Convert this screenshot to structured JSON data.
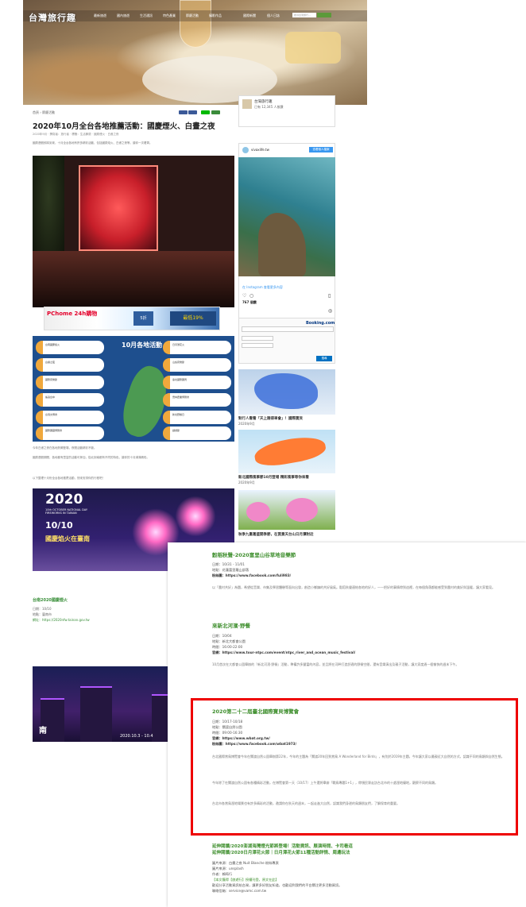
{
  "header": {
    "logo": "台灣旅行趣",
    "nav": [
      "最新旅遊",
      "國內旅遊",
      "生活通訊",
      "特色產業",
      "節慶活動",
      "攝影作品",
      "國際新聞",
      "個人日誌"
    ],
    "search_placeholder": "搜尋台灣旅行..."
  },
  "article": {
    "breadcrumb": "首頁 › 節慶活動",
    "title": "2020年10月全台各地推薦活動：國慶煙火、白晝之夜",
    "meta": "2020年9月 · 撰寫者：旅行者 · 標籤：生活節慶 · 國慶煙火 · 白晝之夜",
    "intro": "國慶連假即將到來，十月全台各地有許多精彩活動，包括國慶焰火、白晝之夜等，讓你一次看齊。",
    "caption1": "今年白晝之夜在各地熱鬧登場，夜間活動精彩不斷。",
    "banner": {
      "brand": "PChome 24h購物",
      "promo1": "5折",
      "promo2": "最低19%"
    },
    "infographic": {
      "title": "10月各地活動",
      "cards": [
        "台南國慶焰火",
        "白晝之夜",
        "國際音樂節",
        "搖滾台中",
        "台灣文博會",
        "國際寶藏博覽會",
        "日月潭花火",
        "山谷音樂節",
        "臺北國際寶貝",
        "雲林農業博覽會",
        "新北野餐日",
        "戲劇節"
      ]
    },
    "para1": "國慶連假期間，各地都有豐富的活動可參加，從北到南都有不同的特色，讓你的十月滿滿精彩。",
    "para2": "以下整理十月份全台各地推薦活動，快來安排你的行程吧！",
    "fireworks": {
      "year": "2020",
      "subtitle": "10th OCTOBER NATIONAL DAY FIREWORKS IN TAINAN",
      "date": "10/10",
      "title": "國慶焰火在臺南"
    },
    "section_title": "台南2020國慶煙火",
    "section_lines": [
      "日期：10/10",
      "地點：臺南市",
      "網址：https://2020nfw.tainan.gov.tw"
    ],
    "photo3": {
      "name": "南",
      "date": "2020.10.3 - 10.4"
    }
  },
  "sidebar": {
    "fb_page": "台灣旅行趣",
    "fb_follow": "已有 12,345 人按讚",
    "ig_user": "vivaxlife.tw",
    "ig_follow": "查看個人檔案",
    "ig_likes": "767 個讚",
    "ig_more": "在 Instagram 查看更多內容",
    "booking": "Booking.com",
    "booking_search": "搜尋",
    "posts": [
      {
        "title": "對行人看看「天上跟得車會」！國際寶貝",
        "date": "2020年9月"
      },
      {
        "title": "新北國際風箏節10月登場 精彩風箏等你來看",
        "date": "2020年9月"
      },
      {
        "title": "秋季九重葛盛開季節，在賞景天台山日月潭附近",
        "date": "2020年9月"
      }
    ]
  },
  "panel": {
    "events": [
      {
        "title": "穀稻秋聲-2020富里山谷草地音樂節",
        "lines": [
          "日期：10/31 - 11/01",
          "地點：花蓮富里羅山部落",
          "粉絲團：https://www.facebook.com/fuli983/"
        ],
        "desc": "以「農村共好」為題，希望從音樂、市集及學習體驗等面向出發，創造小鄉鎮的共好風氣。穀稻秋聲連結各地的好人，一一把好的事情帶到這裡，在每個角落都能感受到農村的美好與溫暖，讓大家看見。"
      },
      {
        "title": "來新北河濱·野餐",
        "lines": [
          "日期：10/04",
          "地點：新北大都會公園",
          "時間：16:00-22:00",
          "官網：https://www.tour-ntpc.com/event/ntpc_river_and_ocean_music_festival/"
        ],
        "desc": "10月首次在大都會公園舉辦的『新北河濱·野餐』活動，準備許多豐富的內容，並且將在河畔打造舒適的野餐空間，還有音樂演出及親子活動，讓大家度過一個愉快的週末下午。"
      },
      {
        "title": "2020第二十二屆臺北國際寶貝博覽會",
        "lines": [
          "日期：10/17-10/18",
          "地點：關渡自然公園",
          "時間：09:00-16:30",
          "官網：https://www.wbat.org.tw/",
          "粉絲團：https://www.facebook.com/wbat1973/"
        ],
        "desc": "台北國際賞鳥博覽會今年在關渡自然公園舉辦第22年，今年的主題為「關渡20年回到賞鳥 A Wonderland for Birds」，有別於2019年主題，今年讓大家以最親近大自然的方式，認識不同的鳥類與自然生態。",
        "desc2": "今年除了在關渡自然公園有各種精彩活動，在博覽會第一天（10/17）上午還將舉辦「戰鳥專題1+1」，帶領民眾走訪台北市的十處溼地棲地，觀察不同的鳥類。",
        "desc3": "台北市各賞鳥溼地場景也有許多精彩的活動，邀請你在秋天的週末，一起走進大自然，認識我們身邊的鳥類朋友們，了解保育的重要。"
      },
      {
        "title": "延伸閱讀/2020澎湖海灣燈光節將登場！活動資訊、展演時間、卡司看這",
        "title2": "延伸閱讀/2020日月潭花火節｜日月潭花火節11種活動詳情、周邊玩法"
      }
    ],
    "credits": [
      "圖片來源：白畫之夜 Nuit Blanche 粉絲專頁",
      "圖片來源：unsplash",
      "作者：賴筠行",
      "【本文獲得【旅遊行】授權刊登，原文在此】",
      "歡迎分享活動資訊給台灣，讓更多好朋友知道，也歡迎到我們的平台關注更多活動資訊。",
      "聯絡信箱：service@vamc.com.tw"
    ]
  }
}
